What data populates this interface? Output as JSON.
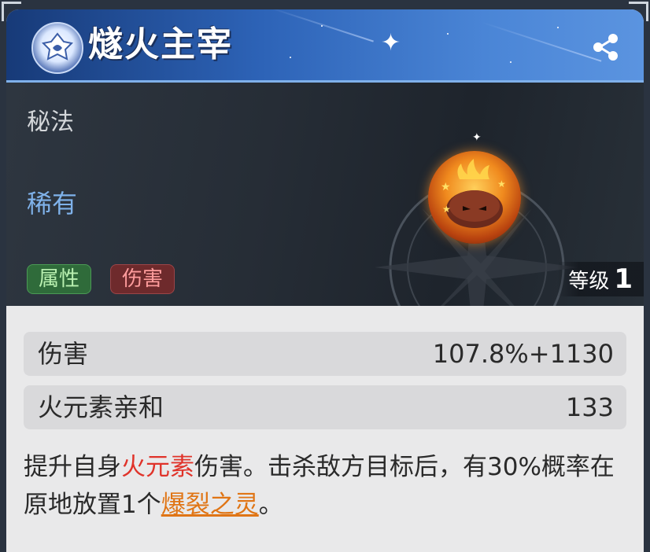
{
  "header": {
    "title": "燧火主宰",
    "emblem_icon": "rune-emblem-icon",
    "share_icon": "share-icon"
  },
  "banner": {
    "type": "秘法",
    "rarity": "稀有",
    "tags": [
      "属性",
      "伤害"
    ],
    "level_label": "等级",
    "level_value": "1",
    "skill_icon": "fire-slime-icon"
  },
  "stats": [
    {
      "name": "伤害",
      "value": "107.8%+1130"
    },
    {
      "name": "火元素亲和",
      "value": "133"
    }
  ],
  "description": {
    "part1": "提升自身",
    "highlight_element": "火元素",
    "part2": "伤害。击杀敌方目标后，有30%概率在原地放置1个",
    "highlight_link": "爆裂之灵",
    "part3": "。"
  },
  "colors": {
    "header_blue": "#2d63b7",
    "rarity_blue": "#7fb2ea",
    "fire_red": "#e0332a",
    "link_orange": "#e07515",
    "tag_green": "#2f6b3a",
    "tag_red": "#6e2a2c"
  }
}
